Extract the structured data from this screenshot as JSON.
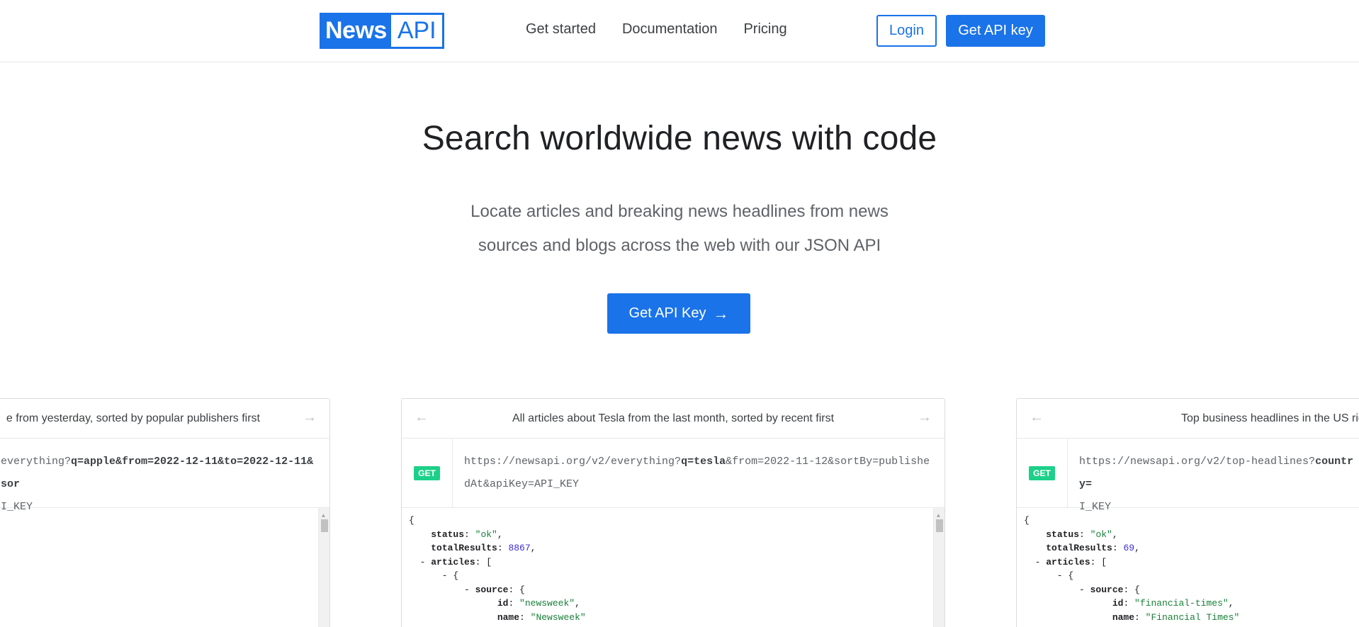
{
  "brand": {
    "logo_left": "News",
    "logo_right": "API"
  },
  "nav": {
    "items": [
      {
        "label": "Get started"
      },
      {
        "label": "Documentation"
      },
      {
        "label": "Pricing"
      }
    ],
    "login_label": "Login",
    "api_key_label": "Get API key"
  },
  "hero": {
    "title": "Search worldwide news with code",
    "subtitle_line1": "Locate articles and breaking news headlines from news",
    "subtitle_line2": "sources and blogs across the web with our JSON API",
    "cta_label": "Get API Key",
    "cta_arrow": "→"
  },
  "icons": {
    "arrow_left": "←",
    "arrow_right": "→",
    "scroll_up": "▲"
  },
  "colors": {
    "accent": "#1a73e8",
    "get_badge": "#1dd089",
    "json_string": "#188038",
    "json_number": "#3b2bd6"
  },
  "examples": {
    "left": {
      "title": "e from yesterday, sorted by popular publishers first",
      "url_line1_pre": "everything?",
      "url_line1_bold": "q=apple&from=2022-12-11&to=2022-12-11&sor",
      "url_line2": "I_KEY"
    },
    "mid": {
      "title": "All articles about Tesla from the last month, sorted by recent first",
      "method": "GET",
      "url_pre": "https://newsapi.org/v2/everything?",
      "url_bold": "q=tesla",
      "url_post": "&from=2022-11-12&sortBy=publishedAt&apiKey=API_KEY",
      "json": {
        "status_key": "status",
        "status_val": "\"ok\"",
        "total_key": "totalResults",
        "total_val": "8867",
        "articles_key": "articles",
        "source_key": "source",
        "id_key": "id",
        "id_val": "\"newsweek\"",
        "name_key": "name",
        "name_val": "\"Newsweek\""
      }
    },
    "right": {
      "title": "Top business headlines in the US rig",
      "method": "GET",
      "url_pre": "https://newsapi.org/v2/top-headlines?",
      "url_bold": "country=",
      "url_line2": "I_KEY",
      "json": {
        "status_key": "status",
        "status_val": "\"ok\"",
        "total_key": "totalResults",
        "total_val": "69",
        "articles_key": "articles",
        "source_key": "source",
        "id_key": "id",
        "id_val": "\"financial-times\"",
        "name_key": "name",
        "name_val": "\"Financial Times\""
      }
    }
  }
}
